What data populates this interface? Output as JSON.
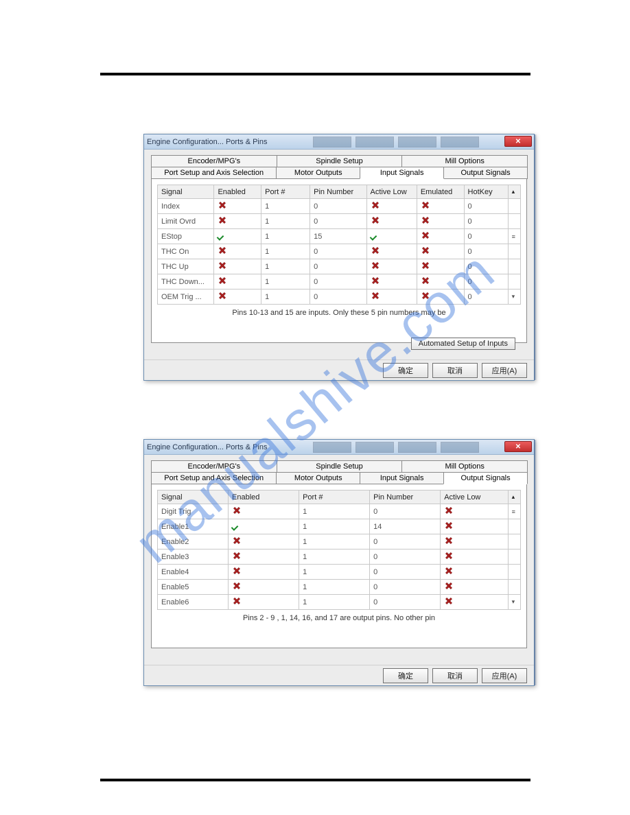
{
  "watermark": "manualshive.com",
  "dialog1": {
    "title": "Engine Configuration... Ports & Pins",
    "tabs_upper": [
      "Encoder/MPG's",
      "Spindle Setup",
      "Mill Options"
    ],
    "tabs_lower": [
      "Port Setup and Axis Selection",
      "Motor Outputs",
      "Input Signals",
      "Output Signals"
    ],
    "active_tab": "Input Signals",
    "columns": [
      "Signal",
      "Enabled",
      "Port #",
      "Pin Number",
      "Active Low",
      "Emulated",
      "HotKey"
    ],
    "rows": [
      {
        "signal": "Index",
        "enabled": "x",
        "port": "1",
        "pin": "0",
        "active_low": "x",
        "emulated": "x",
        "hotkey": "0"
      },
      {
        "signal": "Limit Ovrd",
        "enabled": "x",
        "port": "1",
        "pin": "0",
        "active_low": "x",
        "emulated": "x",
        "hotkey": "0"
      },
      {
        "signal": "EStop",
        "enabled": "v",
        "port": "1",
        "pin": "15",
        "active_low": "v",
        "emulated": "x",
        "hotkey": "0"
      },
      {
        "signal": "THC On",
        "enabled": "x",
        "port": "1",
        "pin": "0",
        "active_low": "x",
        "emulated": "x",
        "hotkey": "0"
      },
      {
        "signal": "THC Up",
        "enabled": "x",
        "port": "1",
        "pin": "0",
        "active_low": "x",
        "emulated": "x",
        "hotkey": "0"
      },
      {
        "signal": "THC Down...",
        "enabled": "x",
        "port": "1",
        "pin": "0",
        "active_low": "x",
        "emulated": "x",
        "hotkey": "0"
      },
      {
        "signal": "OEM Trig ...",
        "enabled": "x",
        "port": "1",
        "pin": "0",
        "active_low": "x",
        "emulated": "x",
        "hotkey": "0"
      }
    ],
    "note": "Pins 10-13 and 15 are inputs. Only these 5 pin numbers may be",
    "auto_button": "Automated Setup of Inputs",
    "buttons": {
      "ok": "确定",
      "cancel": "取消",
      "apply": "应用(A)"
    }
  },
  "dialog2": {
    "title": "Engine Configuration... Ports & Pins",
    "tabs_upper": [
      "Encoder/MPG's",
      "Spindle Setup",
      "Mill Options"
    ],
    "tabs_lower": [
      "Port Setup and Axis Selection",
      "Motor Outputs",
      "Input Signals",
      "Output Signals"
    ],
    "active_tab": "Output Signals",
    "columns": [
      "Signal",
      "Enabled",
      "Port #",
      "Pin Number",
      "Active Low"
    ],
    "rows": [
      {
        "signal": "Digit Trig",
        "enabled": "x",
        "port": "1",
        "pin": "0",
        "active_low": "x"
      },
      {
        "signal": "Enable1",
        "enabled": "v",
        "port": "1",
        "pin": "14",
        "active_low": "x"
      },
      {
        "signal": "Enable2",
        "enabled": "x",
        "port": "1",
        "pin": "0",
        "active_low": "x"
      },
      {
        "signal": "Enable3",
        "enabled": "x",
        "port": "1",
        "pin": "0",
        "active_low": "x"
      },
      {
        "signal": "Enable4",
        "enabled": "x",
        "port": "1",
        "pin": "0",
        "active_low": "x"
      },
      {
        "signal": "Enable5",
        "enabled": "x",
        "port": "1",
        "pin": "0",
        "active_low": "x"
      },
      {
        "signal": "Enable6",
        "enabled": "x",
        "port": "1",
        "pin": "0",
        "active_low": "x"
      }
    ],
    "note": "Pins 2 - 9 , 1, 14, 16, and 17 are output pins. No other pin",
    "buttons": {
      "ok": "确定",
      "cancel": "取消",
      "apply": "应用(A)"
    }
  }
}
